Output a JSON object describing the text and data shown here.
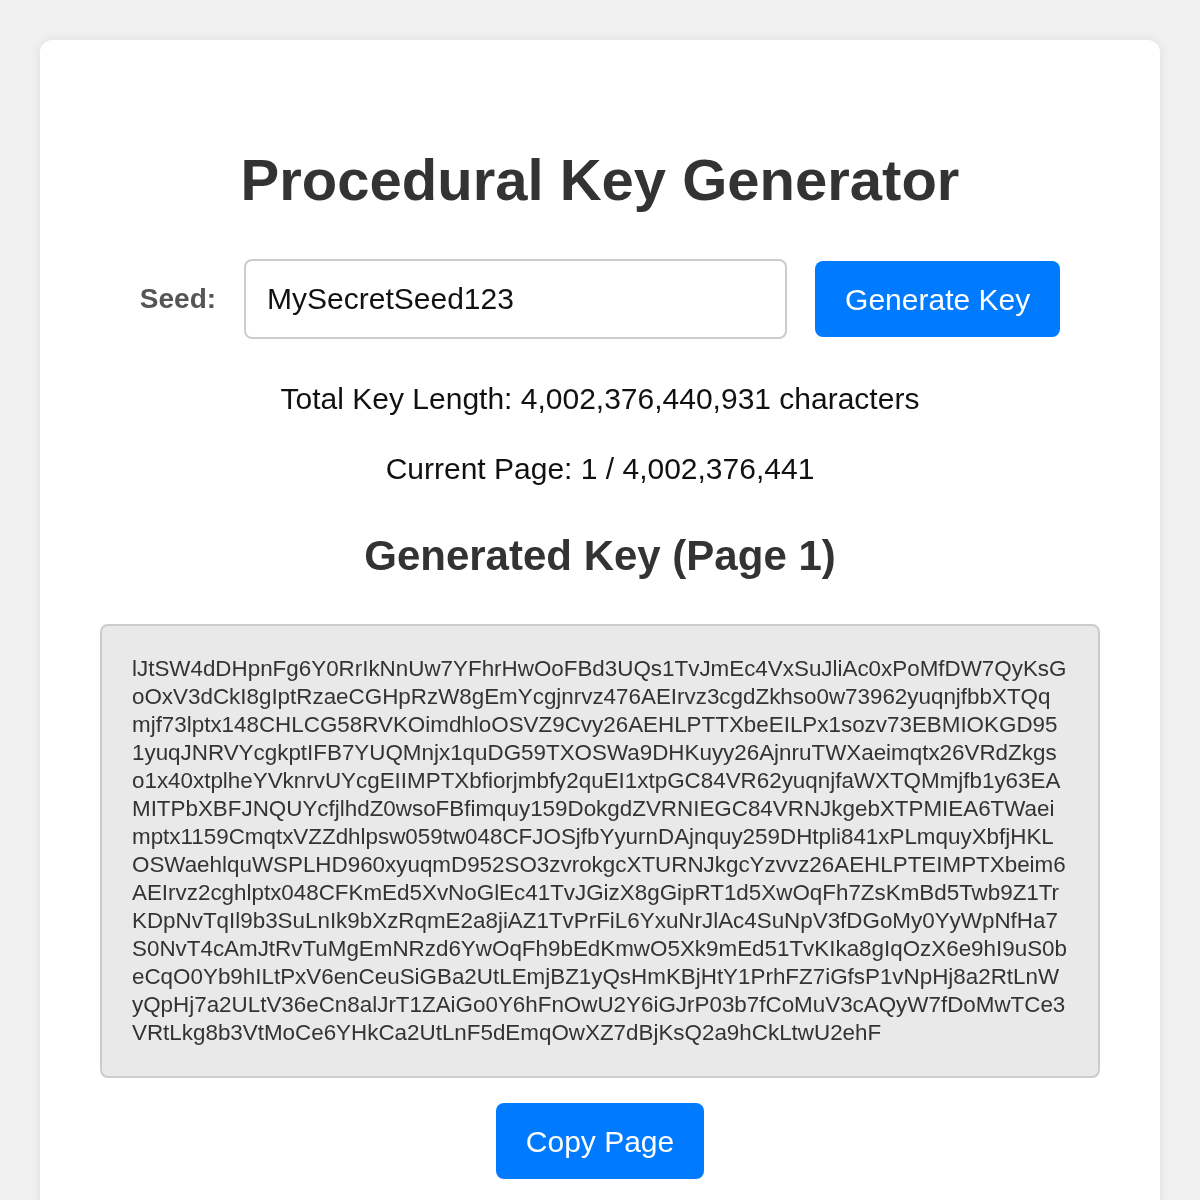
{
  "title": "Procedural Key Generator",
  "seed": {
    "label": "Seed:",
    "value": "MySecretSeed123"
  },
  "generate_button": "Generate Key",
  "total_length": "Total Key Length: 4,002,376,440,931 characters",
  "current_page": "Current Page: 1 / 4,002,376,441",
  "key_heading": "Generated Key (Page 1)",
  "key_text": "lJtSW4dDHpnFg6Y0RrIkNnUw7YFhrHwOoFBd3UQs1TvJmEc4VxSuJliAc0xPoMfDW7QyKsGoOxV3dCkI8gIptRzaeCGHpRzW8gEmYcgjnrvz476AEIrvz3cgdZkhso0w73962yuqnjfbbXTQqmjf73lptx148CHLCG58RVKOimdhloOSVZ9Cvy26AEHLPTTXbeEILPx1sozv73EBMIOKGD951yuqJNRVYcgkptIFB7YUQMnjx1quDG59TXOSWa9DHKuyy26AjnruTWXaeimqtx26VRdZkgso1x40xtplheYVknrvUYcgEIIMPTXbfiorjmbfy2quEI1xtpGC84VR62yuqnjfaWXTQMmjfb1y63EAMITPbXBFJNQUYcfjlhdZ0wsoFBfimquy159DokgdZVRNIEGC84VRNJkgebXTPMIEA6TWaeimptx1159CmqtxVZZdhlpsw059tw048CFJOSjfbYyurnDAjnquy259DHtpli841xPLmquyXbfjHKLOSWaehlquWSPLHD960xyuqmD952SO3zvrokgcXTURNJkgcYzvvz26AEHLPTEIMPTXbeim6AEIrvz2cghlptx048CFKmEd5XvNoGlEc41TvJGizX8gGipRT1d5XwOqFh7ZsKmBd5Twb9Z1TrKDpNvTqIl9b3SuLnIk9bXzRqmE2a8jiAZ1TvPrFiL6YxuNrJlAc4SuNpV3fDGoMy0YyWpNfHa7S0NvT4cAmJtRvTuMgEmNRzd6YwOqFh9bEdKmwO5Xk9mEd51TvKIka8gIqOzX6e9hI9uS0beCqO0Yb9hILtPxV6enCeuSiGBa2UtLEmjBZ1yQsHmKBjHtY1PrhFZ7iGfsP1vNpHj8a2RtLnWyQpHj7a2ULtV36eCn8alJrT1ZAiGo0Y6hFnOwU2Y6iGJrP03b7fCoMuV3cAQyW7fDoMwTCe3VRtLkg8b3VtMoCe6YHkCa2UtLnF5dEmqOwXZ7dBjKsQ2a9hCkLtwU2ehF",
  "copy_button": "Copy Page"
}
